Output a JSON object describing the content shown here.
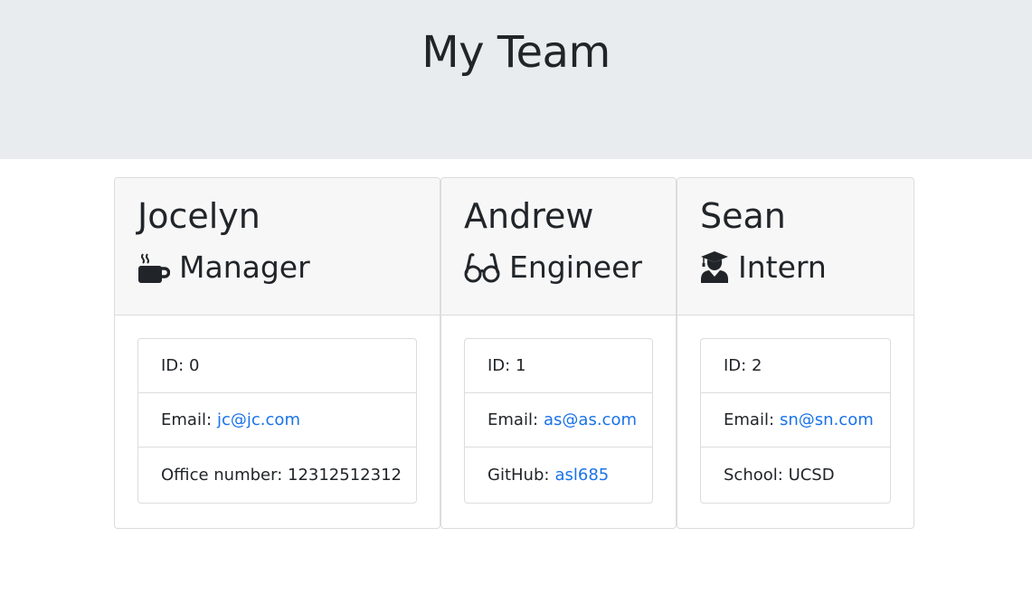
{
  "page": {
    "title": "My Team"
  },
  "team": [
    {
      "name": "Jocelyn",
      "role": "Manager",
      "icon": "coffee-mug-icon",
      "id_label": "ID:",
      "id": "0",
      "email_label": "Email:",
      "email": "jc@jc.com",
      "extra_label": "Office number:",
      "extra": "12312512312"
    },
    {
      "name": "Andrew",
      "role": "Engineer",
      "icon": "glasses-icon",
      "id_label": "ID:",
      "id": "1",
      "email_label": "Email:",
      "email": "as@as.com",
      "extra_label": "GitHub:",
      "extra": "asl685"
    },
    {
      "name": "Sean",
      "role": "Intern",
      "icon": "graduate-icon",
      "id_label": "ID:",
      "id": "2",
      "email_label": "Email:",
      "email": "sn@sn.com",
      "extra_label": "School:",
      "extra": "UCSD"
    }
  ],
  "colors": {
    "header_bg": "#e9ecef",
    "card_header_bg": "#f7f7f7",
    "link": "#1a73e8",
    "text": "#212529"
  }
}
